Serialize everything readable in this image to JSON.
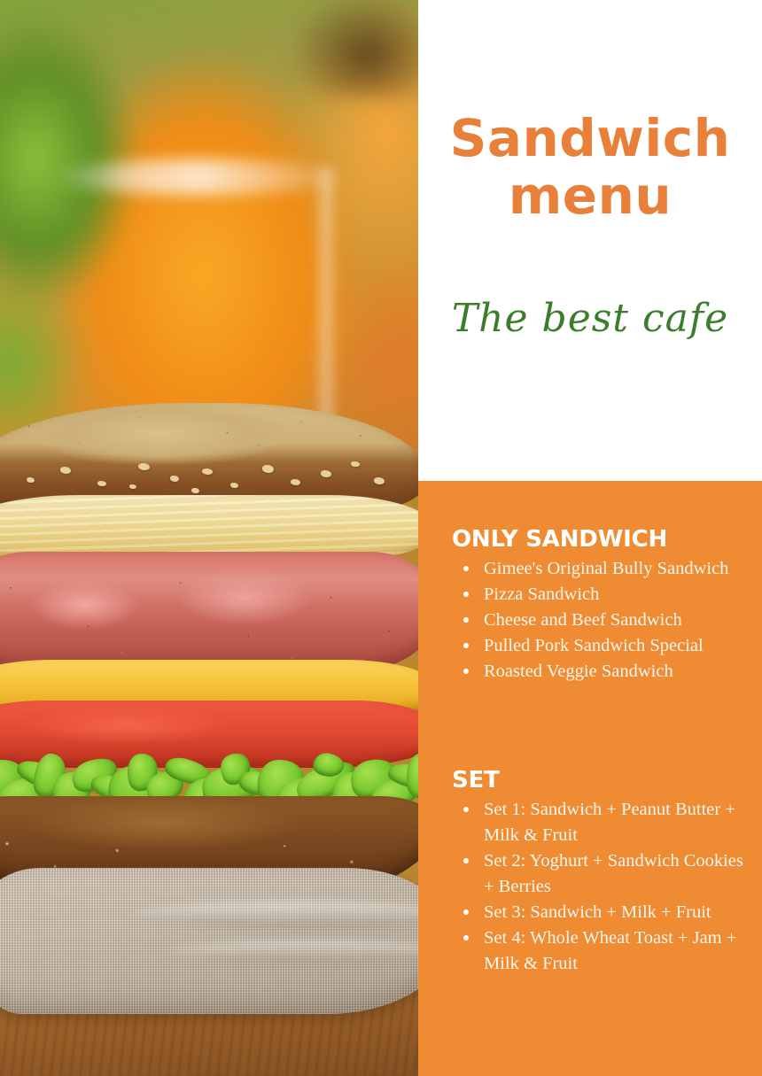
{
  "poster": {
    "title_line1": "Sandwich",
    "title_line2": "menu",
    "subtitle": "The best cafe",
    "colors": {
      "panel_orange": "#ef8b33",
      "title_orange": "#e8803a",
      "subtitle_green": "#3b7d2a",
      "text_white": "#fdf6ee"
    }
  },
  "photo": {
    "alt": "Layered sandwich with bread, cheese, ham, tomato and lettuce on a linen napkin with orange juice in the background"
  },
  "sections": [
    {
      "heading": "ONLY SANDWICH",
      "items": [
        "Gimee's Original Bully Sandwich",
        "Pizza Sandwich",
        "Cheese and Beef Sandwich",
        "Pulled Pork Sandwich Special",
        "Roasted Veggie Sandwich"
      ]
    },
    {
      "heading": "SET",
      "items": [
        "Set 1: Sandwich + Peanut Butter + Milk & Fruit",
        "Set 2: Yoghurt + Sandwich Cookies + Berries",
        "Set 3: Sandwich + Milk + Fruit",
        "Set 4: Whole Wheat Toast + Jam + Milk & Fruit"
      ]
    }
  ]
}
